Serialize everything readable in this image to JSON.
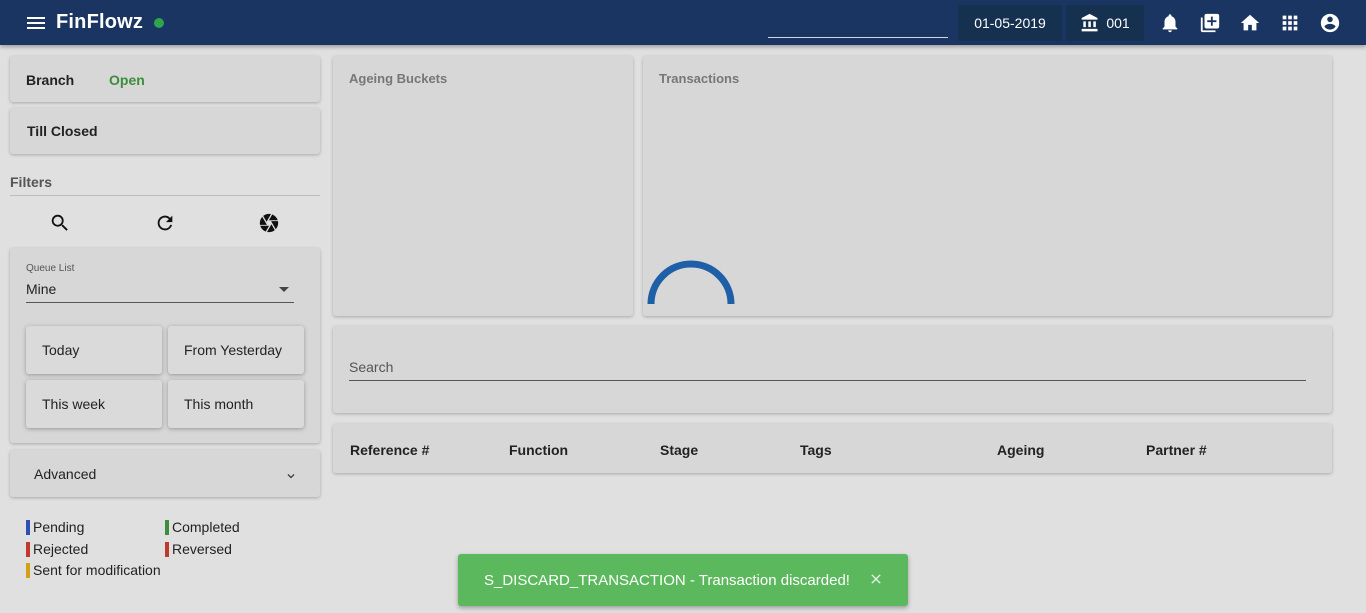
{
  "header": {
    "brand": "FinFlowz",
    "date": "01-05-2019",
    "branch_code": "001",
    "icons": [
      "menu-icon",
      "bank-icon",
      "bell-icon",
      "add-box-icon",
      "home-icon",
      "apps-icon",
      "account-circle-icon"
    ]
  },
  "sidebar": {
    "branch_label": "Branch",
    "branch_status": "Open",
    "till_label": "Till Closed",
    "filters_title": "Filters",
    "filter_icons": [
      "search-icon",
      "refresh-icon",
      "aperture-icon"
    ],
    "queue_label": "Queue List",
    "queue_value": "Mine",
    "quick_filters": {
      "today": "Today",
      "yesterday": "From Yesterday",
      "week": "This week",
      "month": "This month"
    },
    "advanced": "Advanced",
    "legend": {
      "pending": "Pending",
      "completed": "Completed",
      "rejected": "Rejected",
      "reversed": "Reversed",
      "modification": "Sent for modification"
    }
  },
  "colors": {
    "topbar": "#1a3561",
    "open_status": "#3c8d3c",
    "pending": "#2f4fb5",
    "completed": "#3c8d3c",
    "rejected": "#c0392b",
    "reversed": "#c0392b",
    "modification": "#d4a017",
    "toast": "#5cb85c",
    "spinner": "#1f5fa8"
  },
  "panels": {
    "ageing_title": "Ageing Buckets",
    "transactions_title": "Transactions"
  },
  "search": {
    "placeholder": "Search"
  },
  "table": {
    "columns": [
      "Reference #",
      "Function",
      "Stage",
      "Tags",
      "Ageing",
      "Partner #"
    ]
  },
  "toast": {
    "message": "S_DISCARD_TRANSACTION - Transaction discarded!"
  }
}
